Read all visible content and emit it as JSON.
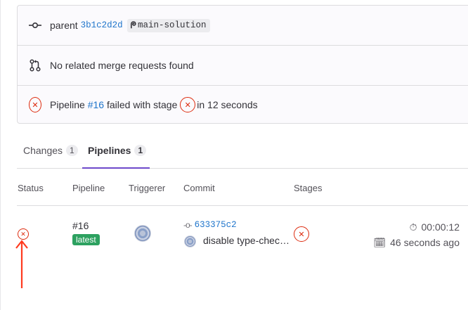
{
  "info": {
    "commit_prefix": "parent",
    "commit_sha": "3b1c2d2d",
    "branch_glyph": "ᖘ",
    "branch": "main-solution",
    "merge_requests": "No related merge requests found",
    "pipeline_prefix": "Pipeline",
    "pipeline_link": "#16",
    "pipeline_mid": "failed with stage",
    "pipeline_suffix": "in 12 seconds"
  },
  "tabs": [
    {
      "label": "Changes",
      "count": "1"
    },
    {
      "label": "Pipelines",
      "count": "1"
    }
  ],
  "table": {
    "headers": [
      "Status",
      "Pipeline",
      "Triggerer",
      "Commit",
      "Stages"
    ],
    "row": {
      "pipeline_id": "#16",
      "badge": "latest",
      "commit_sha": "633375c2",
      "commit_message": "disable type-chec…",
      "duration": "00:00:12",
      "finished": "46 seconds ago"
    }
  },
  "colors": {
    "failed": "#dd2b0e",
    "link": "#1f75cb",
    "active_tab": "#6e49cb",
    "badge": "#2da160",
    "annotation": "#ff3b1f"
  }
}
